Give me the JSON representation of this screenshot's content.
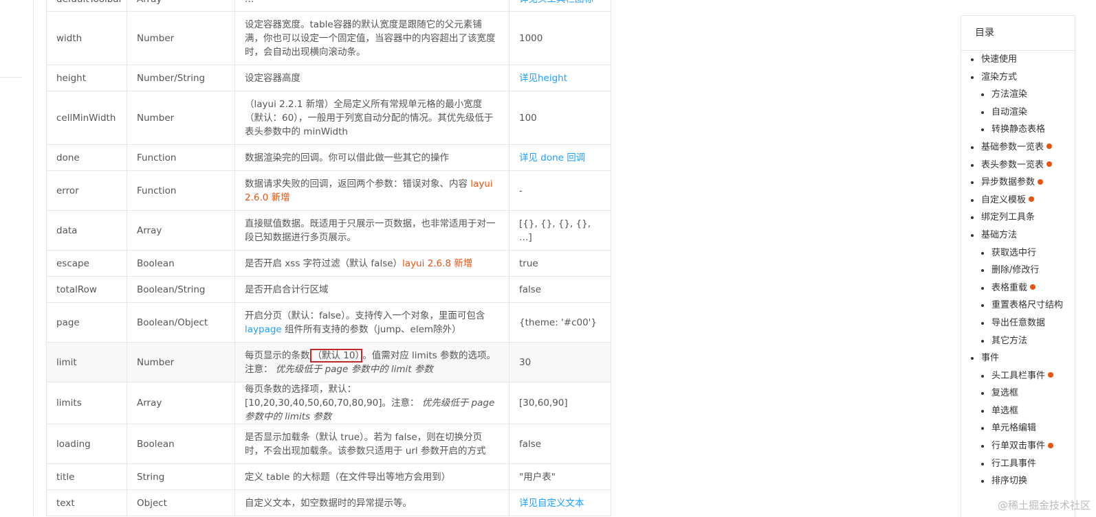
{
  "table": {
    "rows": [
      {
        "name": "defaultToolbar",
        "type": "Array",
        "desc_segments": [
          {
            "text": "…",
            "style": "plain"
          }
        ],
        "value_segments": [
          {
            "text": "详见头工具栏图标",
            "style": "link"
          }
        ],
        "height": 36
      },
      {
        "name": "width",
        "type": "Number",
        "desc_segments": [
          {
            "text": "设定容器宽度。table容器的默认宽度是跟随它的父元素铺满，你也可以设定一个固定值，当容器中的内容超出了该宽度时，会自动出现横向滚动条。",
            "style": "plain"
          }
        ],
        "value_segments": [
          {
            "text": "1000",
            "style": "plain"
          }
        ],
        "height": 78
      },
      {
        "name": "height",
        "type": "Number/String",
        "desc_segments": [
          {
            "text": "设定容器高度",
            "style": "plain"
          }
        ],
        "value_segments": [
          {
            "text": "详见height",
            "style": "link"
          }
        ],
        "height": 38
      },
      {
        "name": "cellMinWidth",
        "type": "Number",
        "desc_segments": [
          {
            "text": "（layui 2.2.1 新增）全局定义所有常规单元格的最小宽度（默认：60），一般用于列宽自动分配的情况。其优先级低于表头参数中的 minWidth",
            "style": "plain"
          }
        ],
        "value_segments": [
          {
            "text": "100",
            "style": "plain"
          }
        ],
        "height": 78
      },
      {
        "name": "done",
        "type": "Function",
        "desc_segments": [
          {
            "text": "数据渲染完的回调。你可以借此做一些其它的操作",
            "style": "plain"
          }
        ],
        "value_segments": [
          {
            "text": "详见 done 回调",
            "style": "link"
          }
        ],
        "height": 38
      },
      {
        "name": "error",
        "type": "Function",
        "desc_segments": [
          {
            "text": "数据请求失败的回调，返回两个参数：错误对象、内容 ",
            "style": "plain"
          },
          {
            "text": "layui 2.6.0 新增",
            "style": "new"
          }
        ],
        "value_segments": [
          {
            "text": "-",
            "style": "plain"
          }
        ],
        "height": 58
      },
      {
        "name": "data",
        "type": "Array",
        "desc_segments": [
          {
            "text": "直接赋值数据。既适用于只展示一页数据，也非常适用于对一段已知数据进行多页展示。",
            "style": "plain"
          }
        ],
        "value_segments": [
          {
            "text": "[{}, {}, {}, {}, …]",
            "style": "plain"
          }
        ],
        "height": 58
      },
      {
        "name": "escape",
        "type": "Boolean",
        "desc_segments": [
          {
            "text": "是否开启 xss 字符过滤（默认 false）",
            "style": "plain"
          },
          {
            "text": "layui 2.6.8 新增",
            "style": "new"
          }
        ],
        "value_segments": [
          {
            "text": "true",
            "style": "plain"
          }
        ],
        "height": 38
      },
      {
        "name": "totalRow",
        "type": "Boolean/String",
        "desc_segments": [
          {
            "text": "是否开启合计行区域",
            "style": "plain"
          }
        ],
        "value_segments": [
          {
            "text": "false",
            "style": "plain"
          }
        ],
        "height": 38
      },
      {
        "name": "page",
        "type": "Boolean/Object",
        "desc_segments": [
          {
            "text": "开启分页（默认：false）。支持传入一个对象，里面可包含 ",
            "style": "plain"
          },
          {
            "text": "laypage",
            "style": "link"
          },
          {
            "text": " 组件所有支持的参数（jump、elem除外）",
            "style": "plain"
          }
        ],
        "value_segments": [
          {
            "text": "{theme: '#c00'}",
            "style": "plain"
          }
        ],
        "height": 58
      },
      {
        "name": "limit",
        "type": "Number",
        "highlight": true,
        "desc_segments": [
          {
            "text": "每页显示的条数",
            "style": "plain"
          },
          {
            "text": "（默认 10）",
            "style": "box"
          },
          {
            "text": "。值需对应 limits 参数的选项。注意：",
            "style": "plain"
          },
          {
            "text": " 优先级低于 page 参数中的 limit 参数",
            "style": "italic"
          }
        ],
        "value_segments": [
          {
            "text": "30",
            "style": "plain"
          }
        ],
        "height": 58
      },
      {
        "name": "limits",
        "type": "Array",
        "desc_segments": [
          {
            "text": "每页条数的选择项，默认：[10,20,30,40,50,60,70,80,90]。注意：",
            "style": "plain"
          },
          {
            "text": " 优先级低于 page 参数中的 limits 参数",
            "style": "italic"
          }
        ],
        "value_segments": [
          {
            "text": "[30,60,90]",
            "style": "plain"
          }
        ],
        "height": 58
      },
      {
        "name": "loading",
        "type": "Boolean",
        "desc_segments": [
          {
            "text": "是否显示加载条（默认 true）。若为 false，则在切换分页时，不会出现加载条。该参数只适用于 url 参数开启的方式",
            "style": "plain"
          }
        ],
        "value_segments": [
          {
            "text": "false",
            "style": "plain"
          }
        ],
        "height": 58
      },
      {
        "name": "title",
        "type": "String",
        "desc_segments": [
          {
            "text": "定义 table 的大标题（在文件导出等地方会用到）",
            "style": "plain"
          }
        ],
        "value_segments": [
          {
            "text": "\"用户表\"",
            "style": "plain"
          }
        ],
        "height": 38
      },
      {
        "name": "text",
        "type": "Object",
        "desc_segments": [
          {
            "text": "自定义文本，如空数据时的异常提示等。",
            "style": "plain"
          }
        ],
        "value_segments": [
          {
            "text": "详见自定义文本",
            "style": "link"
          }
        ],
        "height": 38
      }
    ]
  },
  "toc": {
    "title": "目录",
    "items": [
      {
        "label": "快速使用",
        "level": 1,
        "new": false
      },
      {
        "label": "渲染方式",
        "level": 1,
        "new": false
      },
      {
        "label": "方法渲染",
        "level": 2,
        "new": false
      },
      {
        "label": "自动渲染",
        "level": 2,
        "new": false
      },
      {
        "label": "转换静态表格",
        "level": 2,
        "new": false
      },
      {
        "label": "基础参数一览表",
        "level": 1,
        "new": true
      },
      {
        "label": "表头参数一览表",
        "level": 1,
        "new": true
      },
      {
        "label": "异步数据参数",
        "level": 1,
        "new": true
      },
      {
        "label": "自定义模板",
        "level": 1,
        "new": true
      },
      {
        "label": "绑定列工具条",
        "level": 1,
        "new": false
      },
      {
        "label": "基础方法",
        "level": 1,
        "new": false
      },
      {
        "label": "获取选中行",
        "level": 2,
        "new": false
      },
      {
        "label": "删除/修改行",
        "level": 2,
        "new": false
      },
      {
        "label": "表格重载",
        "level": 2,
        "new": true
      },
      {
        "label": "重置表格尺寸结构",
        "level": 2,
        "new": false
      },
      {
        "label": "导出任意数据",
        "level": 2,
        "new": false
      },
      {
        "label": "其它方法",
        "level": 2,
        "new": false
      },
      {
        "label": "事件",
        "level": 1,
        "new": false
      },
      {
        "label": "头工具栏事件",
        "level": 2,
        "new": true
      },
      {
        "label": "复选框",
        "level": 2,
        "new": false
      },
      {
        "label": "单选框",
        "level": 2,
        "new": false
      },
      {
        "label": "单元格编辑",
        "level": 2,
        "new": false
      },
      {
        "label": "行单双击事件",
        "level": 2,
        "new": true
      },
      {
        "label": "行工具事件",
        "level": 2,
        "new": false
      },
      {
        "label": "排序切换",
        "level": 2,
        "new": false
      }
    ]
  },
  "watermark": "@稀土掘金技术社区"
}
